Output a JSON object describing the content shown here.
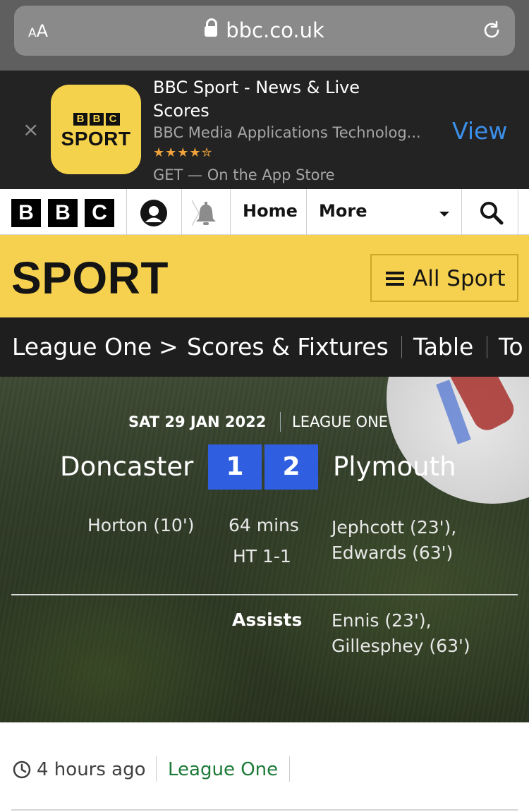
{
  "browser": {
    "text_size_label": "AA",
    "url": "bbc.co.uk"
  },
  "app_banner": {
    "close_glyph": "×",
    "icon_bbc_letters": [
      "B",
      "B",
      "C"
    ],
    "icon_word": "SPORT",
    "title": "BBC Sport - News & Live Scores",
    "developer": "BBC Media Applications Technolog...",
    "rating_stars": "★★★★✮",
    "rating": 4.5,
    "get_text": "GET — On the App Store",
    "view_label": "View",
    "view_color": "#3c8fea"
  },
  "bbc_nav": {
    "logo_letters": [
      "B",
      "B",
      "C"
    ],
    "account_icon": "account-icon",
    "notifications_icon": "bell-icon",
    "home_label": "Home",
    "more_label": "More",
    "search_icon": "search-icon"
  },
  "sport_header": {
    "title": "SPORT",
    "all_sport_label": "All Sport",
    "brand_color": "#f6d14f"
  },
  "sub_nav": {
    "items": [
      "League One",
      "Scores & Fixtures",
      "Table",
      "To"
    ],
    "chevron": ">"
  },
  "match": {
    "date": "SAT 29 JAN 2022",
    "competition": "LEAGUE ONE",
    "home_team": "Doncaster",
    "away_team": "Plymouth",
    "home_score": "1",
    "away_score": "2",
    "home_scorers": "Horton (10')",
    "status": "64 mins",
    "half_time": "HT 1-1",
    "away_scorers": [
      "Jephcott (23'),",
      "Edwards (63')"
    ],
    "assists_label": "Assists",
    "away_assists": [
      "Ennis (23'),",
      "Gillesphey (63')"
    ],
    "score_color": "#2f5ee0"
  },
  "meta": {
    "time_ago": "4 hours ago",
    "league_link": "League One",
    "league_color": "#1b7a36"
  }
}
